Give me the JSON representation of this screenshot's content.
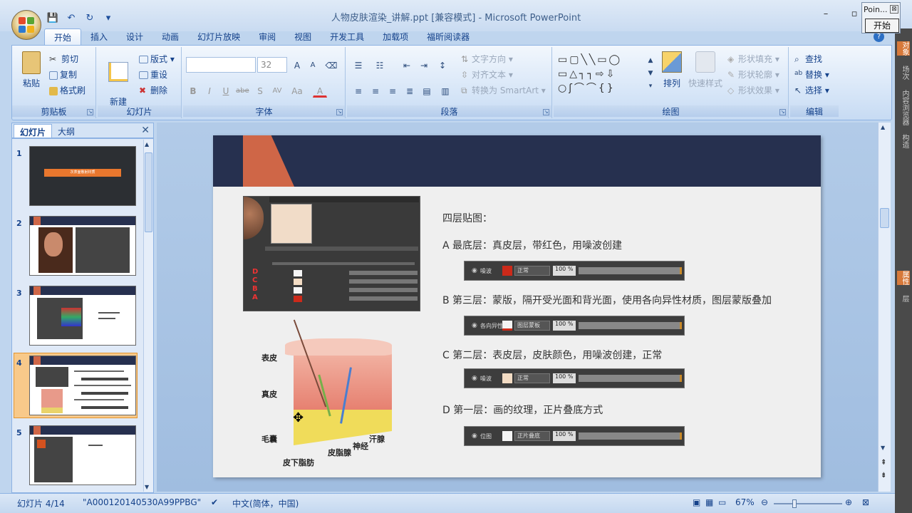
{
  "window": {
    "title": "人物皮肤渲染_讲解.ppt [兼容模式] - Microsoft PowerPoint",
    "minimize": "–",
    "maximize": "▫",
    "close": "✕"
  },
  "quick_access": {
    "save": "💾",
    "undo": "↶",
    "redo": "↻",
    "more": "▾"
  },
  "point_widget": {
    "title": "Poin...",
    "close": "⊠",
    "button": "开始"
  },
  "tabs": [
    "开始",
    "插入",
    "设计",
    "动画",
    "幻灯片放映",
    "审阅",
    "视图",
    "开发工具",
    "加载项",
    "福昕阅读器"
  ],
  "ribbon": {
    "clipboard": {
      "label": "剪贴板",
      "paste": "粘贴",
      "cut": "剪切",
      "copy": "复制",
      "format_painter": "格式刷"
    },
    "slides": {
      "label": "幻灯片",
      "new_slide": "新建\n幻灯片",
      "layout": "版式",
      "reset": "重设",
      "delete": "删除"
    },
    "font": {
      "label": "字体",
      "font_name": "",
      "font_size": "32",
      "grow": "A",
      "shrink": "A",
      "bold": "B",
      "italic": "I",
      "underline": "U",
      "strike": "abe",
      "shadow": "S",
      "spacing": "AV",
      "case": "Aa",
      "color": "A"
    },
    "paragraph": {
      "label": "段落",
      "text_direction": "文字方向",
      "align_text": "对齐文本",
      "smartart": "转换为 SmartArt"
    },
    "drawing": {
      "label": "绘图",
      "arrange": "排列",
      "quick_styles": "快速样式",
      "shape_fill": "形状填充",
      "shape_outline": "形状轮廓",
      "shape_effects": "形状效果"
    },
    "editing": {
      "label": "编辑",
      "find": "查找",
      "replace": "替换",
      "select": "选择"
    }
  },
  "panel": {
    "tab_slides": "幻灯片",
    "tab_outline": "大纲",
    "close": "✕",
    "thumbs": [
      {
        "num": "1",
        "title": "次表面散射材质"
      },
      {
        "num": "2"
      },
      {
        "num": "3"
      },
      {
        "num": "4"
      },
      {
        "num": "5"
      }
    ]
  },
  "slide": {
    "heading": "四层贴图：",
    "items": [
      {
        "text": "A 最底层：真皮层，带红色，用噪波创建",
        "layer_name": "噪波",
        "blend": "正常",
        "opacity": "100 %",
        "swatch": "#cc2a1a"
      },
      {
        "text": "B 第三层：蒙版，隔开受光面和背光面，使用各向异性材质，图层蒙版叠加",
        "layer_name": "各向异性",
        "blend": "图层蒙板",
        "opacity": "100 %",
        "swatch": "#f5f5f5"
      },
      {
        "text": "C 第二层：表皮层，皮肤颜色，用噪波创建，正常",
        "layer_name": "噪波",
        "blend": "正常",
        "opacity": "100 %",
        "swatch": "#f3dcc4"
      },
      {
        "text": "D 第一层：画的纹理，正片叠底方式",
        "layer_name": "位图",
        "blend": "正片叠底",
        "opacity": "100 %",
        "swatch": "#f5f5f5"
      }
    ],
    "diagram_labels": {
      "epidermis": "表皮",
      "dermis": "真皮",
      "hair_follicle": "毛囊",
      "subcutaneous": "皮下脂肪",
      "sebaceous": "皮脂腺",
      "nerve": "神经",
      "sweat_gland": "汗腺"
    }
  },
  "right_strip": [
    "对象",
    "场次",
    "内容浏览器",
    "构造",
    "属性",
    "层"
  ],
  "status": {
    "slide_pos": "幻灯片 4/14",
    "theme": "\"A000120140530A99PPBG\"",
    "language": "中文(简体，中国)",
    "zoom": "67%"
  },
  "colors": {
    "ribbon_text": "#15428b",
    "slide_band": "#26304f",
    "slide_accent": "#cf6647",
    "selected_thumb": "#f8c98a"
  }
}
